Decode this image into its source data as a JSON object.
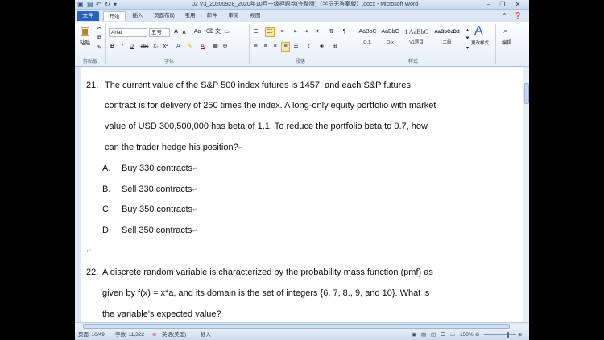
{
  "window": {
    "title": "02 V3_20200928_2020年10月一级押题卷(完整版)【学员无答案版】.docx - Microsoft Word",
    "minimize": "–",
    "restore": "❐",
    "close": "✕"
  },
  "tabs": [
    "文件",
    "开始",
    "插入",
    "页面布局",
    "引用",
    "邮件",
    "审阅",
    "视图"
  ],
  "ribbon": {
    "paste_label": "粘贴",
    "font_name": "Arial",
    "font_size": "五号",
    "font_grow": "A",
    "font_shrink": "A",
    "change_case": "Aa",
    "bold": "B",
    "italic": "I",
    "underline": "U",
    "strikethrough": "abc",
    "subscript": "x₂",
    "superscript": "x²",
    "styles": [
      {
        "preview": "AaBbC",
        "name": "Q.1."
      },
      {
        "preview": "AaBbC",
        "name": "Q-x"
      },
      {
        "preview": "1 AaBbC",
        "name": "V1题目"
      },
      {
        "preview": "AaBbCcDd",
        "name": "二级"
      }
    ],
    "change_styles": "更改样式",
    "edit": "编辑",
    "groups": {
      "clipboard": "剪贴板",
      "font": "字体",
      "paragraph": "段落",
      "styles": "样式"
    }
  },
  "document": {
    "q21": {
      "number": "21.",
      "lines": [
        "The current value of the S&P 500 index futures is 1457, and each S&P futures",
        "contract is for delivery of 250 times the index. A long-only equity portfolio with market",
        "value of USD 300,500,000 has beta of 1.1. To reduce the portfolio beta to 0.7, how",
        "can the trader hedge his position?"
      ],
      "options": [
        {
          "letter": "A.",
          "text": "Buy 330 contracts"
        },
        {
          "letter": "B.",
          "text": "Sell 330 contracts"
        },
        {
          "letter": "C.",
          "text": "Buy 350 contracts"
        },
        {
          "letter": "D.",
          "text": "Sell 350 contracts"
        }
      ]
    },
    "q22": {
      "number": "22.",
      "lines": [
        "A discrete random variable is characterized by the probability mass function (pmf) as",
        "given by f(x) = x*a, and its domain is the set of integers {6, 7, 8., 9, and 10}. What is",
        "the variable's expected value?"
      ]
    },
    "para_mark": "↵"
  },
  "status": {
    "page": "页面: 10/49",
    "words": "字数: 11,322",
    "language": "英语(美国)",
    "insert": "插入",
    "zoom": "150%"
  }
}
